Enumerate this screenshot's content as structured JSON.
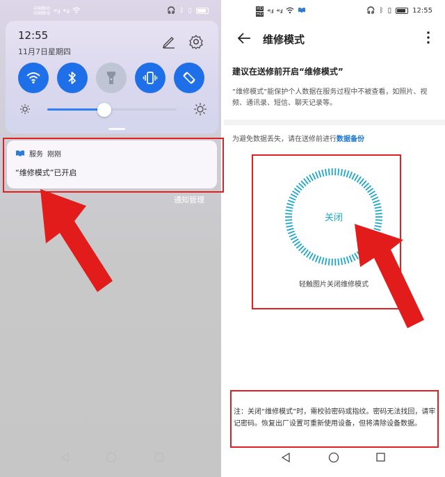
{
  "left": {
    "status": {
      "carrier1": "中国移动",
      "carrier2": "中国移动",
      "sig1": "⁴⁶.ıl",
      "sig2": "⁴⁶.ıl"
    },
    "quick_settings": {
      "time": "12:55",
      "date": "11月7日星期四",
      "tiles": [
        {
          "name": "wifi",
          "active": true
        },
        {
          "name": "bluetooth",
          "active": true
        },
        {
          "name": "flashlight",
          "active": false
        },
        {
          "name": "vibrate",
          "active": true
        },
        {
          "name": "auto-rotate",
          "active": true
        }
      ],
      "brightness": 0.44
    },
    "notification": {
      "app": "服务",
      "time": "刚刚",
      "body": "“维修模式”已开启"
    },
    "manage_label": "通知管理"
  },
  "right": {
    "status": {
      "carrier1": "HD",
      "carrier2": "HD",
      "time": "12:55"
    },
    "header": {
      "title": "维修模式"
    },
    "headline": "建议在送修前开启“维修模式”",
    "description": "“维修模式”能保护个人数据在服务过程中不被查看，如照片、视频、通讯录、短信、聊天记录等。",
    "backup_prefix": "为避免数据丢失，请在送修前进行",
    "backup_link": "数据备份",
    "toggle_label": "关闭",
    "toggle_caption": "轻触图片关闭维修模式",
    "note": "注：关闭“维修模式”时，需校验密码或指纹。密码无法找回，请牢记密码。恢复出厂设置可重新使用设备，但将清除设备数据。"
  },
  "colors": {
    "accent": "#1e6fe8",
    "annotation": "#e02020",
    "ring": "#1aa6c9",
    "link": "#1a76d2"
  }
}
